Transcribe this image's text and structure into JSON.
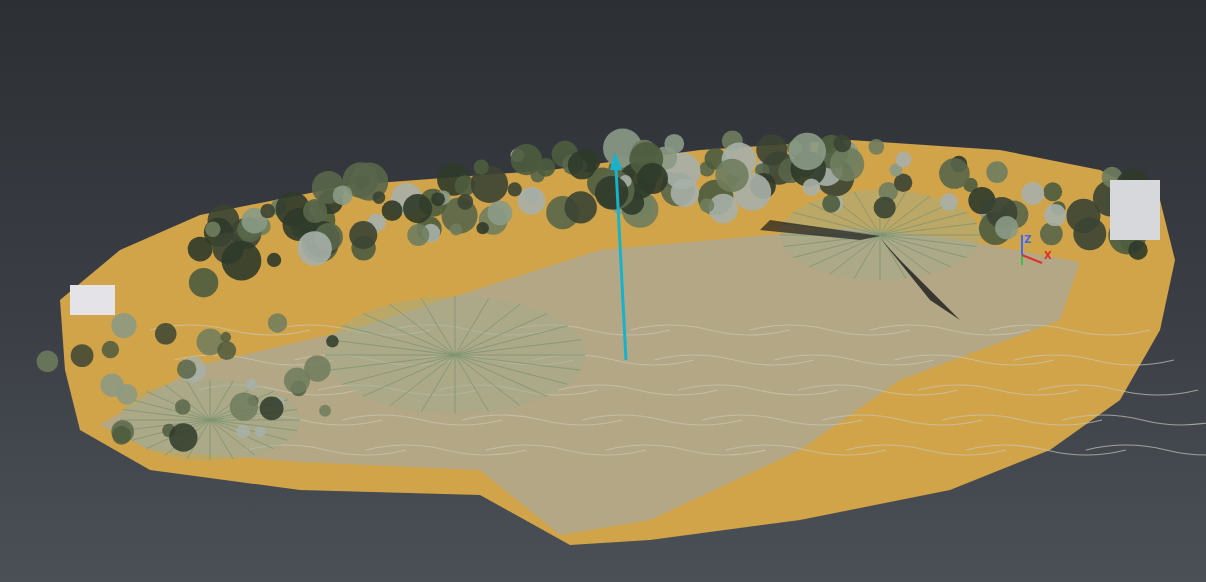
{
  "viewer": {
    "gizmo": {
      "axes": [
        {
          "label": "Z",
          "color": "#3a6bff"
        },
        {
          "label": "X",
          "color": "#e0302a"
        }
      ]
    }
  }
}
